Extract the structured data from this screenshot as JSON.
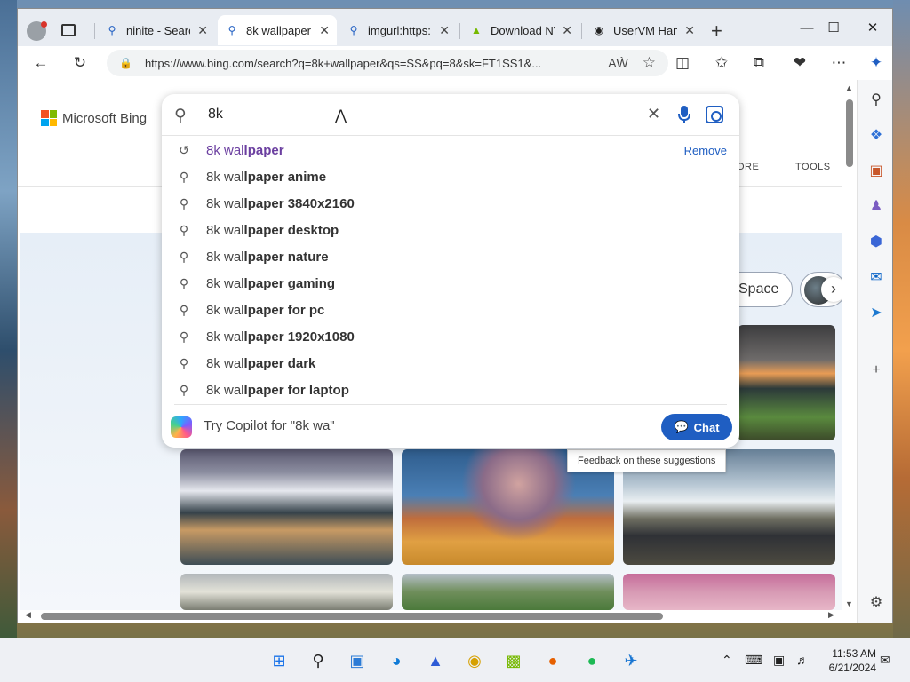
{
  "window": {
    "tabs": [
      {
        "title": "ninite - Searc",
        "icon": "search-icon"
      },
      {
        "title": "8k wallpaper",
        "icon": "search-icon",
        "active": true
      },
      {
        "title": "imgurl:https:",
        "icon": "search-icon"
      },
      {
        "title": "Download NV",
        "icon": "nvidia-icon"
      },
      {
        "title": "UserVM Hand",
        "icon": "github-icon"
      }
    ],
    "new_tab": "+",
    "controls": {
      "minimize": "—",
      "maximize": "☐",
      "close": "✕"
    }
  },
  "toolbar": {
    "url": "https://www.bing.com/search?q=8k+wallpaper&qs=SS&pq=8&sk=FT1SS1&..."
  },
  "page": {
    "brand": "Microsoft Bing",
    "nav": {
      "more": "ORE",
      "tools": "TOOLS"
    },
    "chip_space": "Space",
    "tooltip": "Feedback on these suggestions"
  },
  "search": {
    "query": "8k",
    "suggestions": [
      {
        "prefix": "8k wal",
        "bold": "lpaper",
        "type": "history",
        "action": "Remove"
      },
      {
        "prefix": "8k wal",
        "bold": "lpaper anime"
      },
      {
        "prefix": "8k wal",
        "bold": "lpaper 3840x2160"
      },
      {
        "prefix": "8k wal",
        "bold": "lpaper desktop"
      },
      {
        "prefix": "8k wal",
        "bold": "lpaper nature"
      },
      {
        "prefix": "8k wal",
        "bold": "lpaper gaming"
      },
      {
        "prefix": "8k wal",
        "bold": "lpaper for pc"
      },
      {
        "prefix": "8k wal",
        "bold": "lpaper 1920x1080"
      },
      {
        "prefix": "8k wal",
        "bold": "lpaper dark"
      },
      {
        "prefix": "8k wal",
        "bold": "lpaper for laptop"
      }
    ],
    "copilot_prompt": "Try Copilot for \"8k wa\"",
    "chat_label": "Chat"
  },
  "taskbar": {
    "time": "11:53 AM",
    "date": "6/21/2024"
  },
  "colors": {
    "accent": "#1f5ec2",
    "history_text": "#6b3fa0"
  }
}
